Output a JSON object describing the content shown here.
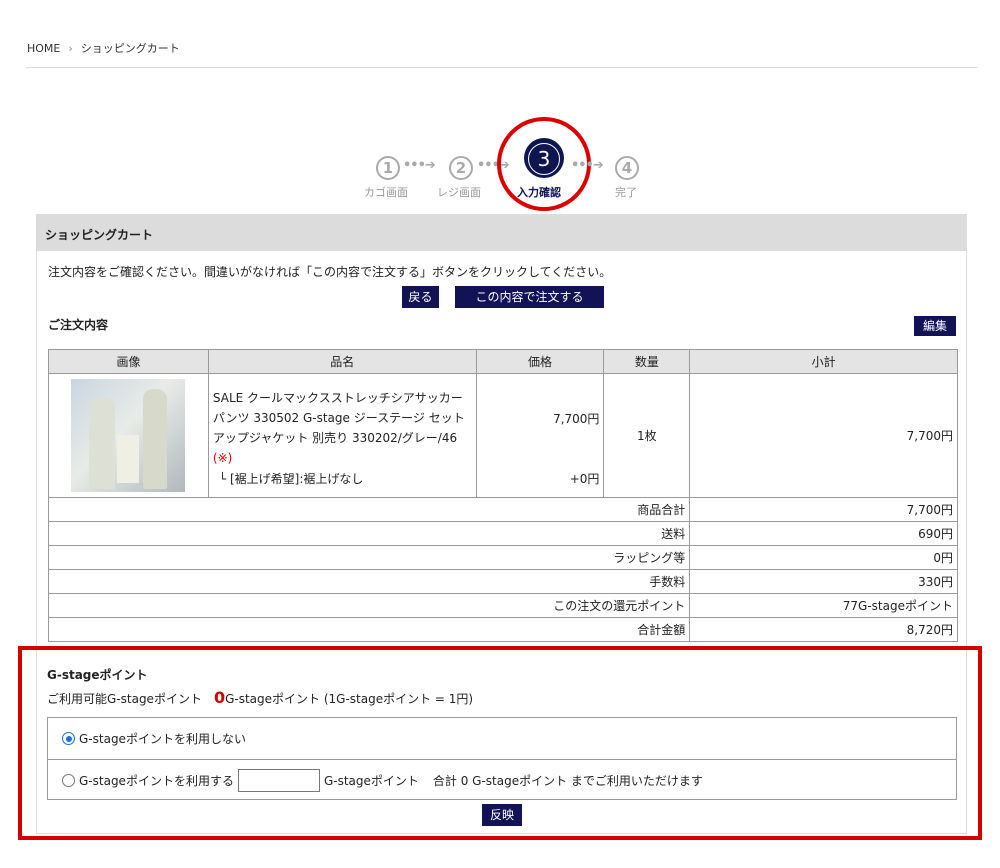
{
  "breadcrumb": {
    "home": "HOME",
    "separator": "›",
    "current": "ショッピングカート"
  },
  "steps": [
    {
      "num": "1",
      "label": "カゴ画面"
    },
    {
      "num": "2",
      "label": "レジ画面"
    },
    {
      "num": "3",
      "label": "入力確認",
      "current": true
    },
    {
      "num": "4",
      "label": "完了"
    }
  ],
  "panel": {
    "title": "ショッピングカート",
    "notice": "注文内容をご確認ください。間違いがなければ「この内容で注文する」ボタンをクリックしてください。",
    "back_button": "戻る",
    "order_button": "この内容で注文する",
    "order_section_title": "ご注文内容",
    "edit_button": "編集"
  },
  "table": {
    "headers": [
      "画像",
      "品名",
      "価格",
      "数量",
      "小計"
    ],
    "item": {
      "name": "SALE クールマックスストレッチシアサッカーパンツ 330502 G-stage ジーステージ セットアップジャケット 別売り 330202/グレー/46",
      "mark": "(※)",
      "option": "└ [裾上げ希望]:裾上げなし",
      "price": "7,700円",
      "option_price": "+0円",
      "qty": "1枚",
      "subtotal": "7,700円"
    },
    "summary": [
      {
        "label": "商品合計",
        "value": "7,700円"
      },
      {
        "label": "送料",
        "value": "690円"
      },
      {
        "label": "ラッピング等",
        "value": "0円"
      },
      {
        "label": "手数料",
        "value": "330円"
      },
      {
        "label": "この注文の還元ポイント",
        "value": "77G-stageポイント"
      },
      {
        "label": "合計金額",
        "value": "8,720円"
      }
    ]
  },
  "points": {
    "title": "G-stageポイント",
    "available_label": "ご利用可能G-stageポイント",
    "available_value": "0",
    "available_suffix": "G-stageポイント (1G-stageポイント = 1円)",
    "option_none": "G-stageポイントを利用しない",
    "option_use": "G-stageポイントを利用する",
    "use_unit": "G-stageポイント",
    "use_note": "合計 0 G-stageポイント までご利用いただけます",
    "input_value": "",
    "apply_button": "反映"
  },
  "colors": {
    "accent": "#121257",
    "highlight_red": "#d40000",
    "radio_blue": "#1a6fe0"
  }
}
